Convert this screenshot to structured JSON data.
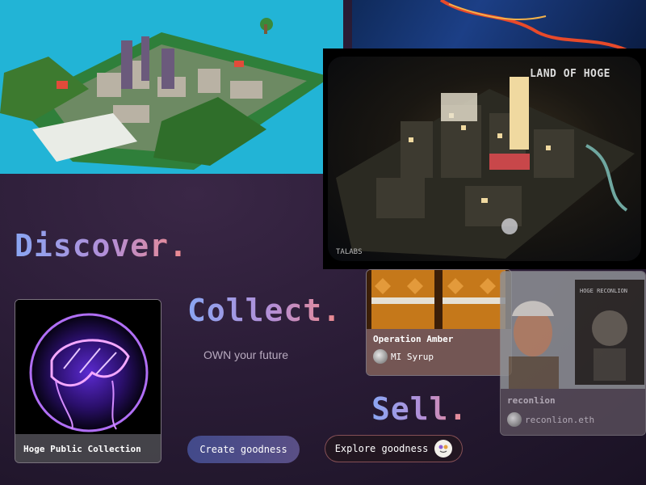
{
  "hero_images": {
    "night_city_title": "LAND OF HOGE",
    "night_city_watermark": "TALABS"
  },
  "headings": {
    "discover": "Discover.",
    "collect": "Collect.",
    "sell": "Sell."
  },
  "tagline": "OWN your future",
  "cards": [
    {
      "title": "Hoge Public Collection"
    },
    {
      "title": "Operation Amber",
      "owner": "MI Syrup"
    },
    {
      "title": "reconlion",
      "owner": "reconlion.eth",
      "art_text": "HOGE RECONLION"
    }
  ],
  "buttons": {
    "create": "Create goodness",
    "explore": "Explore goodness"
  },
  "colors": {
    "background": "#2a1c36",
    "heading_gradient_start": "#8aa6f3",
    "heading_gradient_end": "#f08a8a",
    "create_button": "#424a8a"
  }
}
